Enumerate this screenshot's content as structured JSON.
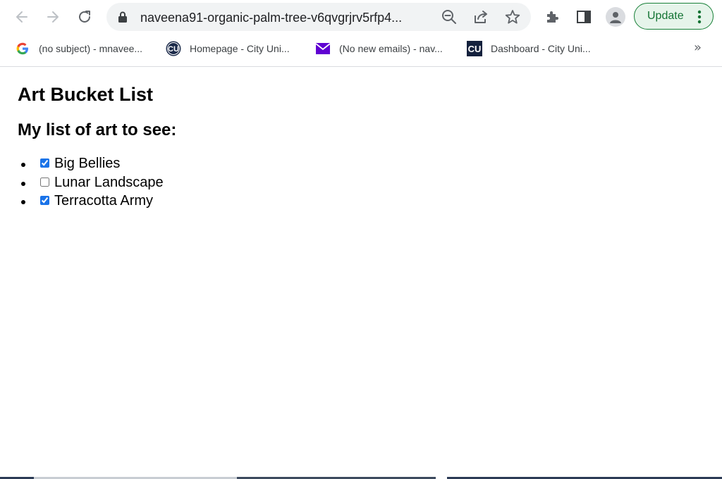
{
  "browser": {
    "url": "naveena91-organic-palm-tree-v6qvgrjrv5rfp4...",
    "update_label": "Update",
    "icons": {
      "back": "arrow-left-icon",
      "forward": "arrow-right-icon",
      "reload": "reload-icon",
      "lock": "lock-icon",
      "zoom": "zoom-out-icon",
      "share": "share-icon",
      "bookmark": "star-icon",
      "extensions": "puzzle-icon",
      "sidepanel": "side-panel-icon",
      "profile": "profile-icon",
      "menu": "three-dots-icon"
    }
  },
  "bookmarks": {
    "items": [
      {
        "label": "(no subject) - mnavee...",
        "icon": "google-icon"
      },
      {
        "label": "Homepage - City Uni...",
        "icon": "cu-round-icon"
      },
      {
        "label": "(No new emails) - nav...",
        "icon": "mail-icon"
      },
      {
        "label": "Dashboard - City Uni...",
        "icon": "cu-square-icon"
      }
    ],
    "overflow": "»"
  },
  "page": {
    "title": "Art Bucket List",
    "subtitle": "My list of art to see:",
    "items": [
      {
        "label": "Big Bellies",
        "checked": true
      },
      {
        "label": "Lunar Landscape",
        "checked": false
      },
      {
        "label": "Terracotta Army",
        "checked": true
      }
    ]
  },
  "colors": {
    "update_border": "#188038",
    "update_text": "#137333",
    "accent": "#1a73e8"
  }
}
